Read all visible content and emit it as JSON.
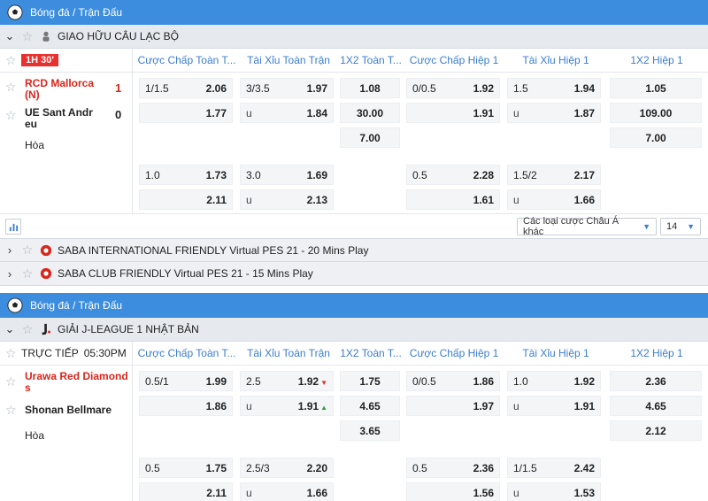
{
  "sections": [
    {
      "sport": "Bóng đá / Trận Đấu",
      "league": "GIAO HỮU CÂU LẠC BỘ",
      "status_badge": "1H 30'",
      "columns": [
        "Cược Chấp Toàn T...",
        "Tài Xỉu Toàn Trận",
        "1X2 Toàn T...",
        "Cược Chấp Hiệp 1",
        "Tài Xỉu Hiệp 1",
        "1X2 Hiệp 1"
      ],
      "home": "RCD Mallorca (N)",
      "away": "UE Sant Andr eu",
      "home_score": "1",
      "away_score": "0",
      "draw": "Hòa",
      "rows": [
        [
          "1/1.5",
          "2.06",
          "3/3.5",
          "1.97",
          "1.08",
          "0/0.5",
          "1.92",
          "1.5",
          "1.94",
          "1.05"
        ],
        [
          "",
          "1.77",
          "u",
          "1.84",
          "30.00",
          "",
          "1.91",
          "u",
          "1.87",
          "109.00"
        ],
        [
          "",
          "",
          "",
          "",
          "7.00",
          "",
          "",
          "",
          "",
          "7.00"
        ],
        [
          "1.0",
          "1.73",
          "3.0",
          "1.69",
          "",
          "0.5",
          "2.28",
          "1.5/2",
          "2.17",
          ""
        ],
        [
          "",
          "2.11",
          "u",
          "2.13",
          "",
          "",
          "1.61",
          "u",
          "1.66",
          ""
        ]
      ],
      "odds_type": "Các loại cược Châu Á khác",
      "odds_count": "14"
    },
    {
      "sport": "Bóng đá / Trận Đấu",
      "league": "GIẢI J-LEAGUE 1 NHẬT BẢN",
      "status_live": "TRỰC TIẾP",
      "status_time": "05:30PM",
      "columns": [
        "Cược Chấp Toàn T...",
        "Tài Xỉu Toàn Trận",
        "1X2 Toàn T...",
        "Cược Chấp Hiệp 1",
        "Tài Xỉu Hiệp 1",
        "1X2 Hiệp 1"
      ],
      "home": "Urawa Red Diamond s",
      "away": "Shonan Bellmare",
      "draw": "Hòa",
      "rows": [
        [
          "0.5/1",
          "1.99",
          "2.5",
          "1.92",
          "1.75",
          "0/0.5",
          "1.86",
          "1.0",
          "1.92",
          "2.36"
        ],
        [
          "",
          "1.86",
          "u",
          "1.91",
          "4.65",
          "",
          "1.97",
          "u",
          "1.91",
          "4.65"
        ],
        [
          "",
          "",
          "",
          "",
          "3.65",
          "",
          "",
          "",
          "",
          "2.12"
        ],
        [
          "0.5",
          "1.75",
          "2.5/3",
          "2.20",
          "",
          "0.5",
          "2.36",
          "1/1.5",
          "2.42",
          ""
        ],
        [
          "",
          "2.11",
          "u",
          "1.66",
          "",
          "",
          "1.56",
          "u",
          "1.53",
          ""
        ]
      ]
    }
  ],
  "virtual_leagues": [
    "SABA INTERNATIONAL FRIENDLY Virtual PES 21 - 20 Mins Play",
    "SABA CLUB FRIENDLY Virtual PES 21 - 15 Mins Play"
  ],
  "colors": {
    "header_blue": "#3c8dde",
    "live_red": "#e8302f",
    "link_blue": "#3b7dd0"
  }
}
